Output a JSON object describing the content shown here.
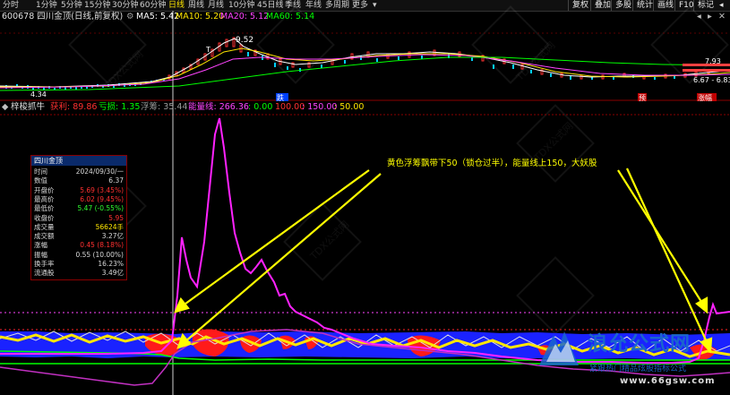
{
  "toolbar": {
    "periods": [
      "分时",
      "1分钟",
      "5分钟",
      "15分钟",
      "30分钟",
      "60分钟",
      "日线",
      "周线",
      "月线",
      "10分钟",
      "45日线",
      "季线",
      "年线",
      "多周期",
      "更多"
    ],
    "selected_period": "日线",
    "buttons": [
      "复权",
      "叠加",
      "多股",
      "统计",
      "画线",
      "F10",
      "标记"
    ],
    "win_controls": [
      "◂",
      "▸",
      "✕"
    ]
  },
  "kline_header": {
    "code_name": "600678 四川金顶(日线,前复权)",
    "ma5": "MA5: 5.42",
    "ma10": "MA10: 5.20",
    "ma20": "MA20: 5.12",
    "ma60": "MA60: 5.14"
  },
  "kline_labels": {
    "high": "9.52",
    "low": "4.34",
    "right1": "7.93",
    "right2": "6.67 - 6.83",
    "marker": "T",
    "bottom_mark": "跌",
    "tag1": "预",
    "tag2": "涨幅"
  },
  "indicator": {
    "name": "梓梭抓牛",
    "v1_label": "获利: 89.86",
    "v2_label": "亏损: 1.35",
    "v3_label": "浮筹: 35.44",
    "v4_label": "能量线: 266.36",
    "v5": ": 0.00",
    "v6": "100.00",
    "v7": ": 150.00",
    "v8": ": 50.00"
  },
  "annotation": "黄色浮筹飘带下50（锁仓过半），能量线上150，大妖股",
  "popup": {
    "title": "四川金顶",
    "rows": [
      {
        "label": "时间",
        "value": "2024/09/30/一",
        "color": "#d8d8d8"
      },
      {
        "label": "数值",
        "value": "6.37",
        "color": "#d8d8d8"
      },
      {
        "label": "开盘价",
        "value": "5.69 (3.45%)",
        "color": "#ff3030"
      },
      {
        "label": "最高价",
        "value": "6.02 (9.45%)",
        "color": "#ff3030"
      },
      {
        "label": "最低价",
        "value": "5.47 (-0.55%)",
        "color": "#30ff30"
      },
      {
        "label": "收盘价",
        "value": "5.95",
        "color": "#ff3030"
      },
      {
        "label": "成交量",
        "value": "56624手",
        "color": "#ffe600"
      },
      {
        "label": "成交额",
        "value": "3.27亿",
        "color": "#d8d8d8"
      },
      {
        "label": "涨幅",
        "value": "0.45 (8.18%)",
        "color": "#ff3030"
      },
      {
        "label": "振幅",
        "value": "0.55 (10.00%)",
        "color": "#d8d8d8"
      },
      {
        "label": "换手率",
        "value": "16.23%",
        "color": "#d8d8d8"
      },
      {
        "label": "流通股",
        "value": "3.49亿",
        "color": "#d8d8d8"
      }
    ]
  },
  "watermark": {
    "brand": "浪允公式网",
    "slogan": "紧跟热门精品炫股指标公式",
    "url": "www.66gsw.com",
    "tile_text": "TDX公式网"
  },
  "colors": {
    "ma5": "#ffffff",
    "ma10": "#ffe600",
    "ma20": "#ff00ff",
    "ma60": "#00ff00",
    "up": "#ff3030",
    "down": "#00d0ff",
    "accent": "#ffe600"
  }
}
